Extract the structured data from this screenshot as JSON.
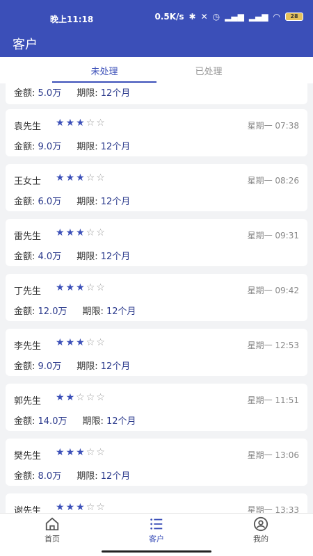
{
  "status": {
    "time": "晚上11:18",
    "speed": "0.5K/s",
    "battery": "28"
  },
  "app": {
    "title": "客户"
  },
  "tabs": {
    "pending": "未处理",
    "done": "已处理"
  },
  "first": {
    "amount_label": "金额: ",
    "amount": "5.0万",
    "term_label": "期限: ",
    "term": "12个月"
  },
  "customers": [
    {
      "name": "袁先生",
      "rating": 3,
      "time": "星期一 07:38",
      "amount_label": "金额: ",
      "amount": "9.0万",
      "term_label": "期限: ",
      "term": "12个月"
    },
    {
      "name": "王女士",
      "rating": 3,
      "time": "星期一 08:26",
      "amount_label": "金额: ",
      "amount": "6.0万",
      "term_label": "期限: ",
      "term": "12个月"
    },
    {
      "name": "雷先生",
      "rating": 3,
      "time": "星期一 09:31",
      "amount_label": "金额: ",
      "amount": "4.0万",
      "term_label": "期限: ",
      "term": "12个月"
    },
    {
      "name": "丁先生",
      "rating": 3,
      "time": "星期一 09:42",
      "amount_label": "金额: ",
      "amount": "12.0万",
      "term_label": "期限: ",
      "term": "12个月"
    },
    {
      "name": "李先生",
      "rating": 3,
      "time": "星期一 12:53",
      "amount_label": "金额: ",
      "amount": "9.0万",
      "term_label": "期限: ",
      "term": "12个月"
    },
    {
      "name": "郭先生",
      "rating": 2,
      "time": "星期一 11:51",
      "amount_label": "金额: ",
      "amount": "14.0万",
      "term_label": "期限: ",
      "term": "12个月"
    },
    {
      "name": "樊先生",
      "rating": 3,
      "time": "星期一 13:06",
      "amount_label": "金额: ",
      "amount": "8.0万",
      "term_label": "期限: ",
      "term": "12个月"
    },
    {
      "name": "谢先生",
      "rating": 3,
      "time": "星期一 13:33",
      "amount_label": "金额: ",
      "amount": "",
      "term_label": "",
      "term": ""
    }
  ],
  "tabbar": {
    "home": "首页",
    "customers": "客户",
    "mine": "我的"
  },
  "colors": {
    "primary": "#3b4fb8"
  }
}
